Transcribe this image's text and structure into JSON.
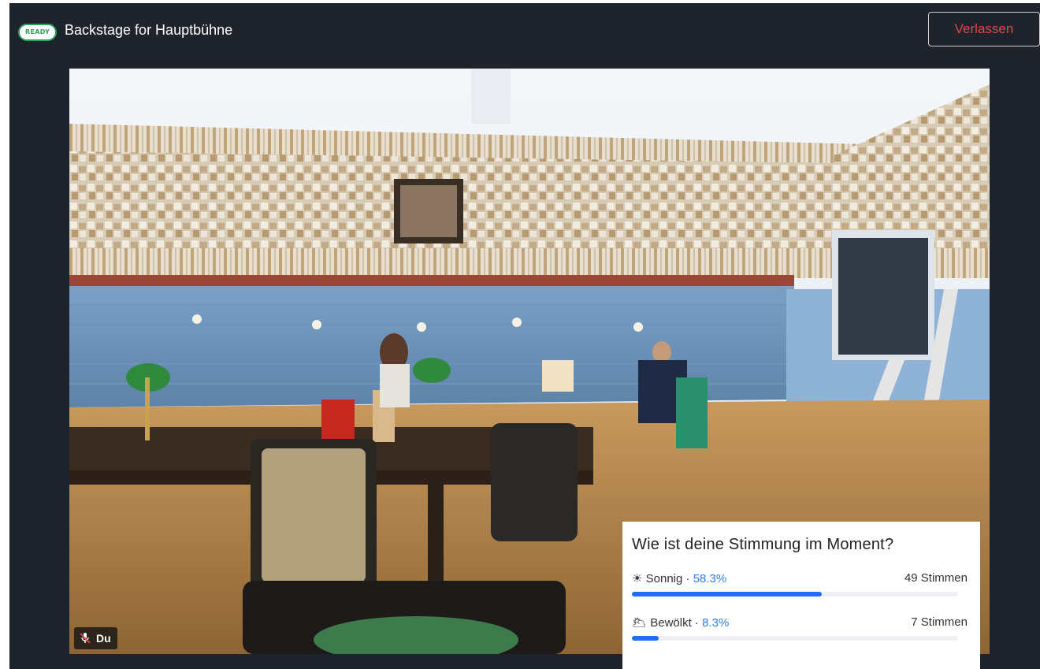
{
  "header": {
    "status_badge": "READY",
    "title": "Backstage for Hauptbühne",
    "leave_label": "Verlassen"
  },
  "video": {
    "participant_label": "Du",
    "mic_icon": "mic-off-icon"
  },
  "poll": {
    "question": "Wie ist deine Stimmung im Moment?",
    "options": [
      {
        "icon": "☀",
        "icon_name": "sun-icon",
        "label": "Sonnig",
        "sep": "·",
        "percent": "58.3%",
        "votes": "49 Stimmen",
        "fraction": 0.583
      },
      {
        "icon": "🌥",
        "icon_name": "cloud-icon",
        "label": "Bewölkt",
        "sep": "·",
        "percent": "8.3%",
        "votes": "7 Stimmen",
        "fraction": 0.083
      }
    ]
  },
  "colors": {
    "background": "#1f232b",
    "accent_green": "#2ea05a",
    "leave_red": "#e0464e",
    "poll_blue": "#1f6ff2"
  }
}
